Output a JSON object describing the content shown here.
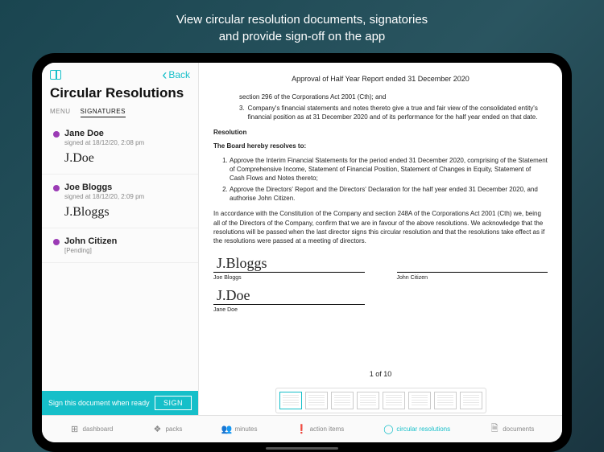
{
  "promo": {
    "line1": "View circular resolution documents, signatories",
    "line2": "and provide sign-off on the app"
  },
  "sidebar": {
    "back_label": "Back",
    "title": "Circular Resolutions",
    "tabs": {
      "menu": "MENU",
      "signatures": "SIGNATURES"
    },
    "signatories": [
      {
        "name": "Jane Doe",
        "meta": "signed at 18/12/20, 2:08 pm",
        "signature": "J.Doe"
      },
      {
        "name": "Joe Bloggs",
        "meta": "signed at 18/12/20, 2:09 pm",
        "signature": "J.Bloggs"
      },
      {
        "name": "John Citizen",
        "meta": "[Pending]",
        "signature": ""
      }
    ],
    "sign_prompt": "Sign this document when ready",
    "sign_button": "SIGN"
  },
  "document": {
    "title": "Approval of Half Year Report ended 31 December 2020",
    "pre_item_a": "section 296 of the Corporations Act 2001 (Cth); and",
    "pre_item_b": "Company's financial statements and notes thereto give a true and fair view of the consolidated entity's financial position as at 31 December 2020 and of its performance for the half year ended on that date.",
    "resolution_h": "Resolution",
    "resolves_h": "The Board hereby resolves to:",
    "res1": "Approve the Interim Financial Statements for the period ended 31 December 2020, comprising of the Statement of Comprehensive Income, Statement of Financial Position, Statement of Changes in Equity, Statement of Cash Flows and Notes thereto;",
    "res2": "Approve the Directors' Report and the Directors' Declaration for the half year ended 31 December 2020, and authorise John Citizen.",
    "para": "In accordance with the Constitution of the Company and section 248A of the Corporations Act 2001 (Cth) we, being all of the Directors of the Company, confirm that we are in favour of the above resolutions. We acknowledge that the resolutions will be passed when the last director signs this circular resolution and that the resolutions take effect as if the resolutions were passed at a meeting of directors.",
    "sig_bloggs": "J.Bloggs",
    "name_bloggs": "Joe Bloggs",
    "name_citizen": "John Citizen",
    "sig_doe": "J.Doe",
    "name_doe": "Jane Doe",
    "page_indicator": "1 of 10"
  },
  "nav": {
    "dashboard": "dashboard",
    "packs": "packs",
    "minutes": "minutes",
    "action_items": "action items",
    "circular": "circular resolutions",
    "documents": "documents"
  }
}
